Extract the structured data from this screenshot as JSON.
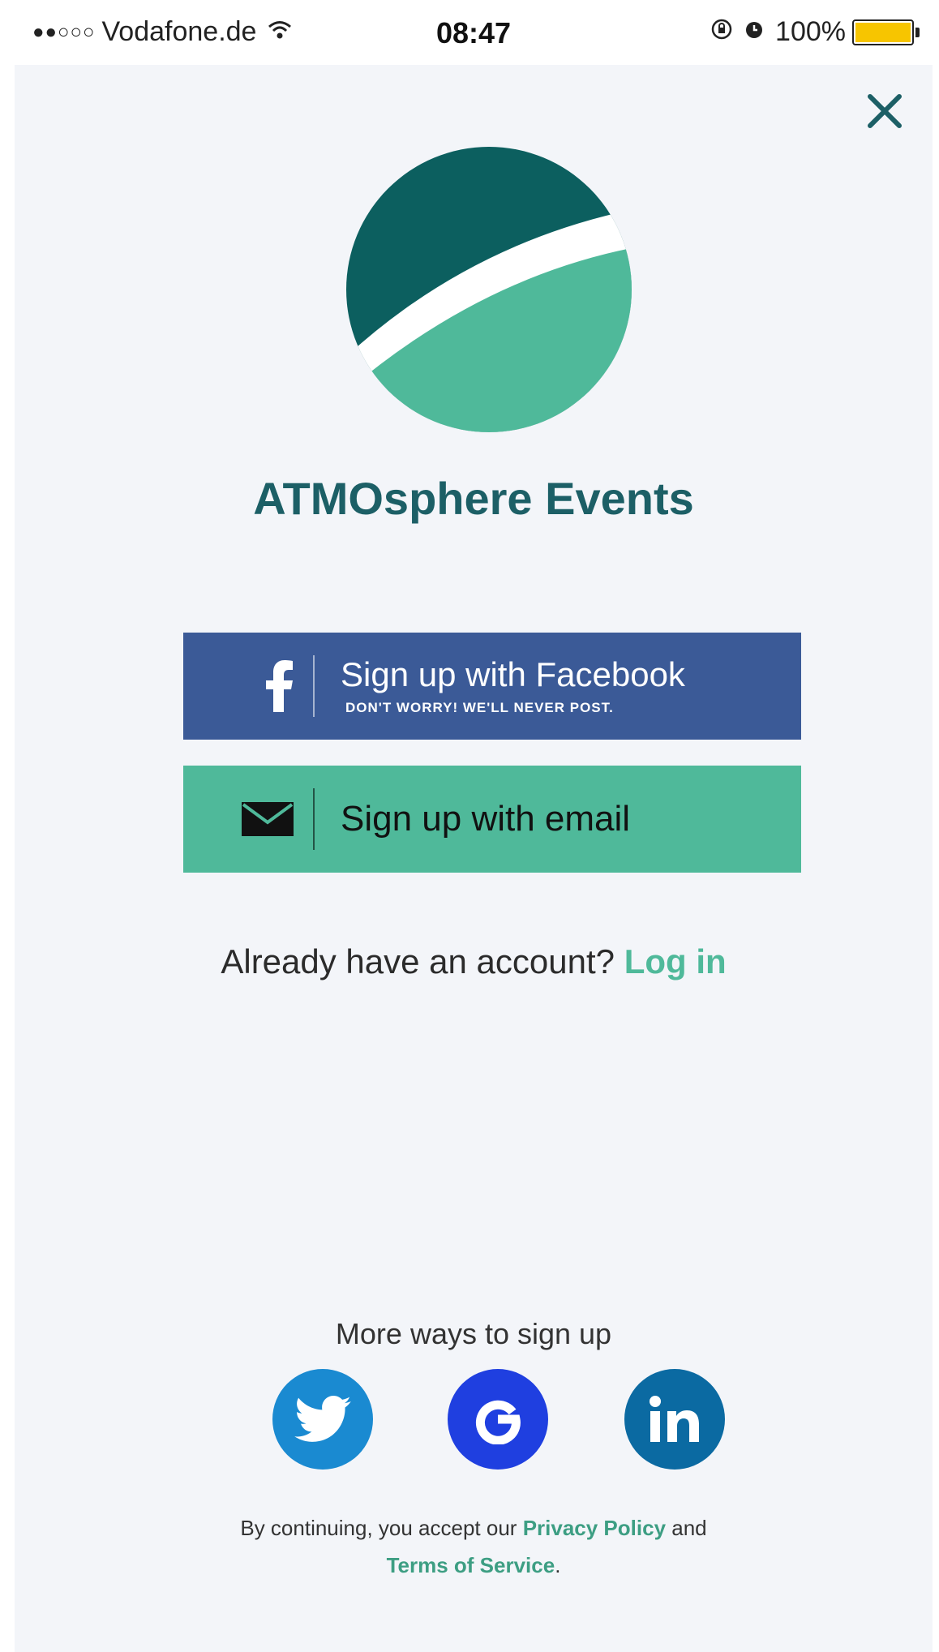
{
  "status_bar": {
    "signal": "●●○○○",
    "carrier": "Vodafone.de",
    "time": "08:47",
    "battery_label": "100%",
    "battery_level_percent": 100,
    "battery_color": "#f7c500",
    "icons": [
      "wifi-icon",
      "orientation-lock-icon",
      "alarm-icon",
      "battery-icon"
    ]
  },
  "header": {
    "close_icon": "close-icon"
  },
  "brand": {
    "name": "ATMOsphere Events",
    "logo_icon": "atmosphere-logo-icon",
    "colors": {
      "primary_dark": "#0c5f5f",
      "primary_light": "#4fb99a",
      "title": "#1c5f66"
    }
  },
  "signup": {
    "facebook": {
      "label": "Sign up with Facebook",
      "sublabel": "DON'T WORRY! WE'LL NEVER POST.",
      "icon": "facebook-icon",
      "color": "#3b5a97"
    },
    "email": {
      "label": "Sign up with email",
      "icon": "envelope-icon",
      "color": "#4fb99a"
    }
  },
  "login": {
    "prompt": "Already have an account? ",
    "link": "Log in"
  },
  "more_ways": {
    "title": "More ways to sign up",
    "providers": [
      {
        "name": "twitter",
        "icon": "twitter-icon",
        "color": "#1a8ad1"
      },
      {
        "name": "google",
        "icon": "google-icon",
        "color": "#1f3fe0"
      },
      {
        "name": "linkedin",
        "icon": "linkedin-icon",
        "color": "#0b6aa2"
      }
    ]
  },
  "legal": {
    "prefix": "By continuing, you accept our ",
    "privacy_link": "Privacy Policy",
    "middle": " and",
    "terms_link": "Terms of Service",
    "suffix": "."
  }
}
